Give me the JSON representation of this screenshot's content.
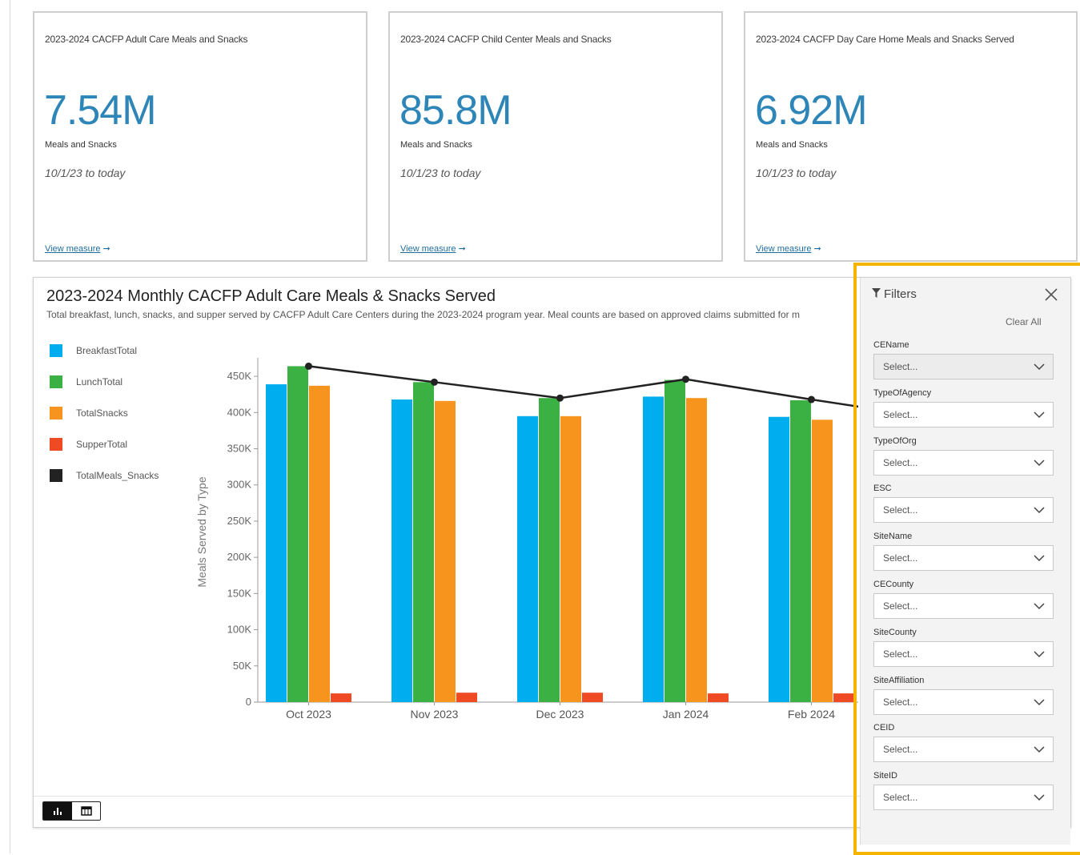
{
  "kpis": [
    {
      "title": "2023-2024 CACFP Adult Care Meals and Snacks",
      "value": "7.54M",
      "unit": "Meals and Snacks",
      "range": "10/1/23 to today",
      "link": "View measure"
    },
    {
      "title": "2023-2024 CACFP Child Center Meals and Snacks",
      "value": "85.8M",
      "unit": "Meals and Snacks",
      "range": "10/1/23 to today",
      "link": "View measure"
    },
    {
      "title": "2023-2024 CACFP Day Care Home Meals and Snacks Served",
      "value": "6.92M",
      "unit": "Meals and Snacks",
      "range": "10/1/23 to today",
      "link": "View measure"
    }
  ],
  "chart": {
    "title": "2023-2024 Monthly CACFP Adult Care Meals & Snacks Served",
    "subtitle": "Total breakfast, lunch, snacks, and supper served by CACFP Adult Care Centers during the 2023-2024 program year. Meal counts are based on approved claims submitted for m"
  },
  "chart_data": {
    "type": "bar",
    "categories": [
      "Oct 2023",
      "Nov 2023",
      "Dec 2023",
      "Jan 2024",
      "Feb 2024"
    ],
    "series": [
      {
        "name": "BreakfastTotal",
        "color": "#00aeef",
        "values": [
          439000,
          418000,
          395000,
          422000,
          394000
        ]
      },
      {
        "name": "LunchTotal",
        "color": "#3bb143",
        "values": [
          464000,
          442000,
          420000,
          445000,
          417000
        ]
      },
      {
        "name": "TotalSnacks",
        "color": "#f7941d",
        "values": [
          437000,
          416000,
          395000,
          420000,
          390000
        ]
      },
      {
        "name": "SupperTotal",
        "color": "#ef4a23",
        "values": [
          12000,
          13000,
          13000,
          12000,
          12000
        ]
      }
    ],
    "line_series": {
      "name": "TotalMeals_Snacks",
      "color": "#222222",
      "values": [
        464000,
        442000,
        420000,
        446000,
        418000
      ],
      "trailing_value": 408000
    },
    "ylabel": "Meals Served by Type",
    "yticks": [
      "0",
      "50K",
      "100K",
      "150K",
      "200K",
      "250K",
      "300K",
      "350K",
      "400K",
      "450K"
    ],
    "ylim": [
      0,
      470000
    ],
    "legend_position": "left"
  },
  "toggles": {
    "chart_icon": "bar-chart-icon",
    "table_icon": "table-icon"
  },
  "filters": {
    "header": "Filters",
    "clear_all": "Clear All",
    "placeholder": "Select...",
    "fields": [
      {
        "label": "CEName"
      },
      {
        "label": "TypeOfAgency"
      },
      {
        "label": "TypeOfOrg"
      },
      {
        "label": "ESC"
      },
      {
        "label": "SiteName"
      },
      {
        "label": "CECounty"
      },
      {
        "label": "SiteCounty"
      },
      {
        "label": "SiteAffiliation"
      },
      {
        "label": "CEID"
      },
      {
        "label": "SiteID"
      }
    ]
  }
}
